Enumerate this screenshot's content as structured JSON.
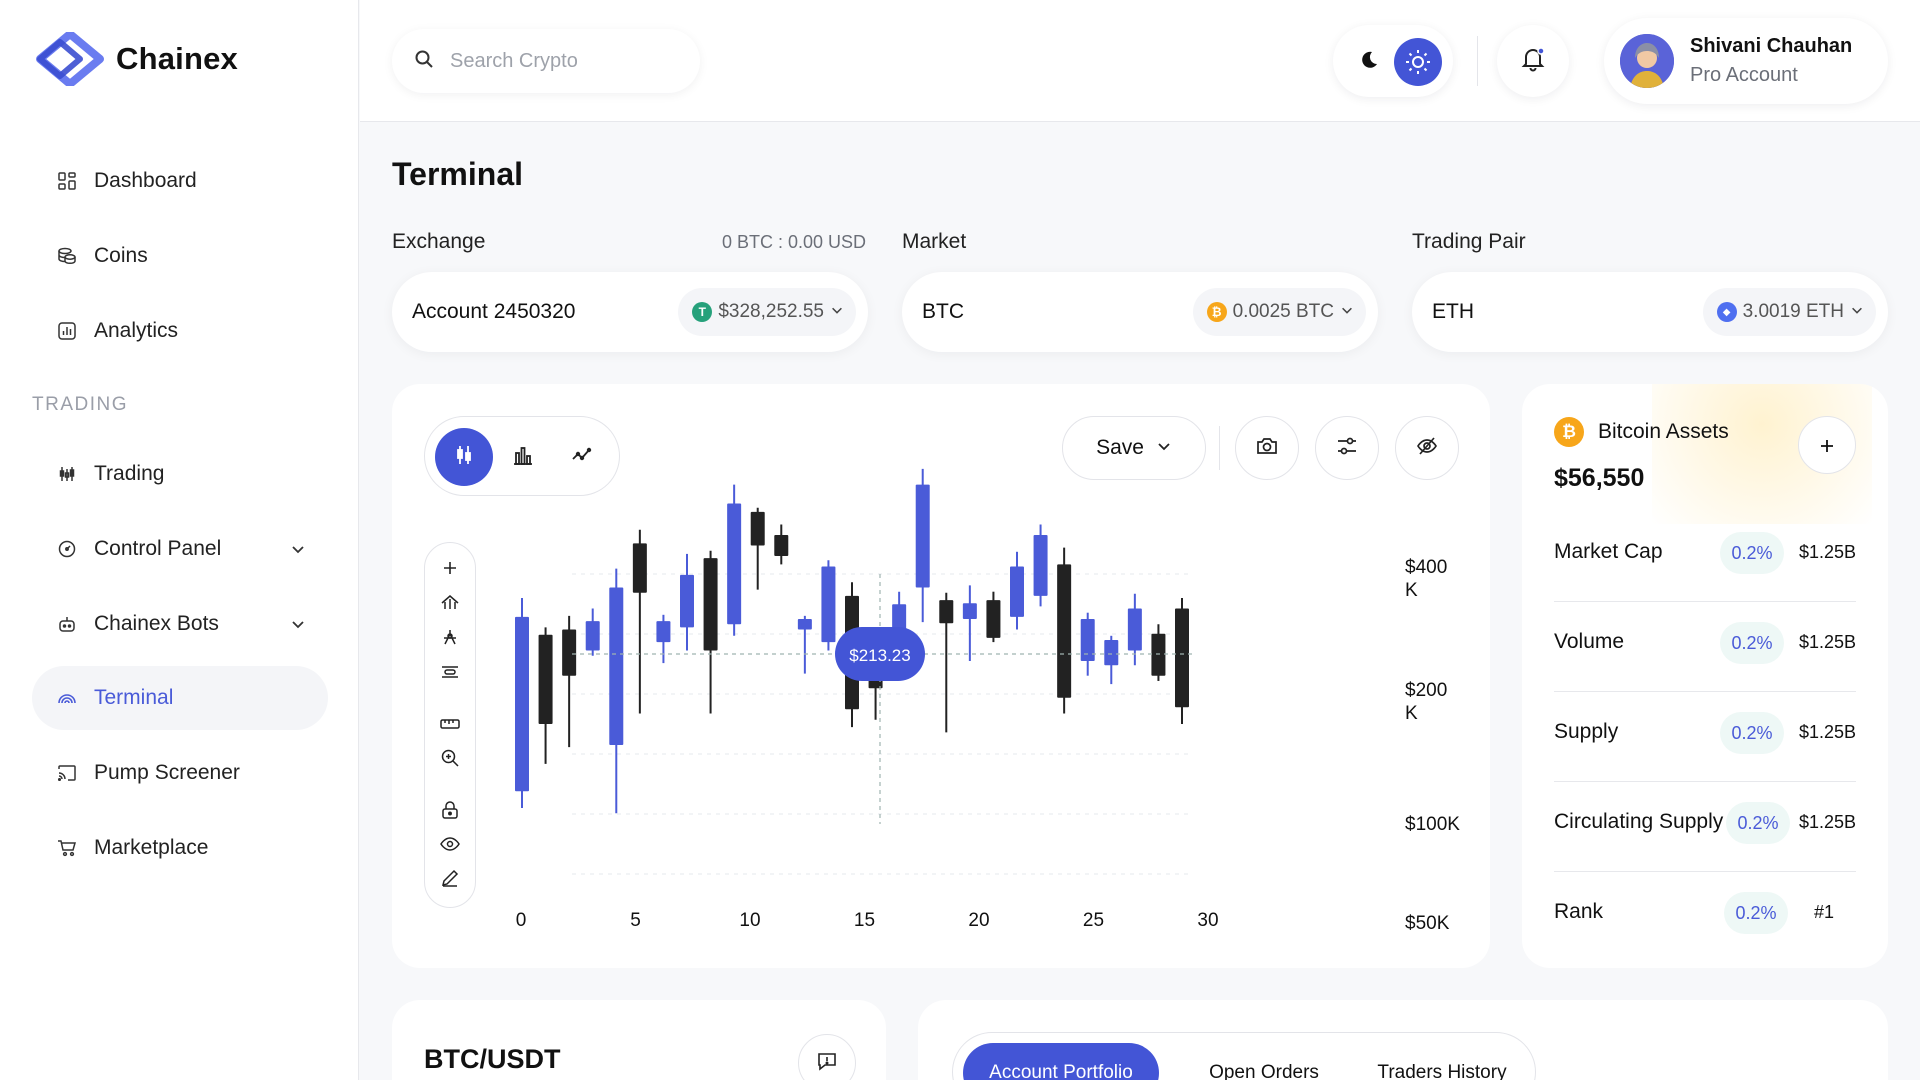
{
  "app": {
    "name": "Chainex"
  },
  "search": {
    "placeholder": "Search Crypto"
  },
  "sidebar": {
    "items": [
      {
        "label": "Dashboard",
        "icon": "grid-icon"
      },
      {
        "label": "Coins",
        "icon": "coins-icon"
      },
      {
        "label": "Analytics",
        "icon": "analytics-icon"
      }
    ],
    "section_label": "TRADING",
    "trading_items": [
      {
        "label": "Trading",
        "icon": "trading-icon"
      },
      {
        "label": "Control Panel",
        "icon": "control-icon",
        "expandable": true
      },
      {
        "label": "Chainex Bots",
        "icon": "bot-icon",
        "expandable": true
      },
      {
        "label": "Terminal",
        "icon": "terminal-icon",
        "active": true
      },
      {
        "label": "Pump Screener",
        "icon": "cast-icon"
      },
      {
        "label": "Marketplace",
        "icon": "cart-icon"
      }
    ]
  },
  "user": {
    "name": "Shivani Chauhan",
    "role": "Pro Account"
  },
  "page": {
    "title": "Terminal"
  },
  "exchange": {
    "label": "Exchange",
    "balance": "0 BTC : 0.00 USD",
    "account": "Account 2450320",
    "amount": "$328,252.55",
    "coin_symbol": "T",
    "coin_color": "#26a17b"
  },
  "market": {
    "label": "Market",
    "value": "BTC",
    "amount": "0.0025 BTC",
    "coin_symbol": "₿",
    "coin_color": "#f7a61a"
  },
  "pair": {
    "label": "Trading Pair",
    "value": "ETH",
    "amount": "3.0019 ETH",
    "coin_symbol": "◆",
    "coin_color": "#4f6ff0"
  },
  "toolbar": {
    "save_label": "Save"
  },
  "chart_data": {
    "type": "candlestick",
    "x_ticks": [
      "0",
      "5",
      "10",
      "15",
      "20",
      "25",
      "30"
    ],
    "y_ticks": [
      {
        "value": 400000,
        "label": "$400 K"
      },
      {
        "value": 200000,
        "label": "$200 K"
      },
      {
        "value": 100000,
        "label": "$100K"
      },
      {
        "value": 50000,
        "label": "$50K"
      }
    ],
    "crosshair_label": "$213.23",
    "colors": {
      "up": "#4a5bd8",
      "down": "#222222"
    },
    "candles": [
      {
        "x": 0,
        "o": 76,
        "c": 242,
        "h": 260,
        "l": 60,
        "up": true
      },
      {
        "x": 1,
        "o": 225,
        "c": 140,
        "h": 232,
        "l": 102,
        "up": false
      },
      {
        "x": 2,
        "o": 230,
        "c": 186,
        "h": 243,
        "l": 118,
        "up": false
      },
      {
        "x": 3,
        "o": 210,
        "c": 238,
        "h": 250,
        "l": 205,
        "up": true
      },
      {
        "x": 4,
        "o": 270,
        "c": 120,
        "h": 288,
        "l": 55,
        "up": true
      },
      {
        "x": 5,
        "o": 312,
        "c": 265,
        "h": 325,
        "l": 150,
        "up": false
      },
      {
        "x": 6,
        "o": 238,
        "c": 218,
        "h": 244,
        "l": 198,
        "up": true
      },
      {
        "x": 7,
        "o": 282,
        "c": 232,
        "h": 302,
        "l": 210,
        "up": true
      },
      {
        "x": 8,
        "o": 298,
        "c": 210,
        "h": 305,
        "l": 150,
        "up": false
      },
      {
        "x": 9,
        "o": 350,
        "c": 235,
        "h": 368,
        "l": 224,
        "up": true
      },
      {
        "x": 10,
        "o": 342,
        "c": 310,
        "h": 346,
        "l": 268,
        "up": false
      },
      {
        "x": 11,
        "o": 320,
        "c": 300,
        "h": 330,
        "l": 292,
        "up": false
      },
      {
        "x": 12,
        "o": 230,
        "c": 240,
        "h": 243,
        "l": 188,
        "up": true
      },
      {
        "x": 13,
        "o": 290,
        "c": 218,
        "h": 296,
        "l": 210,
        "up": true
      },
      {
        "x": 14,
        "o": 262,
        "c": 154,
        "h": 275,
        "l": 137,
        "up": false
      },
      {
        "x": 15,
        "o": 210,
        "c": 174,
        "h": 216,
        "l": 144,
        "up": false
      },
      {
        "x": 16,
        "o": 254,
        "c": 212,
        "h": 266,
        "l": 185,
        "up": true
      },
      {
        "x": 17,
        "o": 368,
        "c": 270,
        "h": 383,
        "l": 237,
        "up": true
      },
      {
        "x": 18,
        "o": 258,
        "c": 236,
        "h": 265,
        "l": 132,
        "up": false
      },
      {
        "x": 19,
        "o": 255,
        "c": 240,
        "h": 272,
        "l": 200,
        "up": true
      },
      {
        "x": 20,
        "o": 258,
        "c": 222,
        "h": 266,
        "l": 218,
        "up": false
      },
      {
        "x": 21,
        "o": 290,
        "c": 242,
        "h": 304,
        "l": 230,
        "up": true
      },
      {
        "x": 22,
        "o": 320,
        "c": 262,
        "h": 330,
        "l": 252,
        "up": true
      },
      {
        "x": 23,
        "o": 292,
        "c": 165,
        "h": 308,
        "l": 150,
        "up": false
      },
      {
        "x": 24,
        "o": 240,
        "c": 200,
        "h": 246,
        "l": 186,
        "up": true
      },
      {
        "x": 25,
        "o": 220,
        "c": 196,
        "h": 224,
        "l": 178,
        "up": true
      },
      {
        "x": 26,
        "o": 250,
        "c": 210,
        "h": 264,
        "l": 196,
        "up": true
      },
      {
        "x": 27,
        "o": 226,
        "c": 186,
        "h": 235,
        "l": 181,
        "up": false
      },
      {
        "x": 28,
        "o": 250,
        "c": 156,
        "h": 260,
        "l": 140,
        "up": false
      }
    ]
  },
  "assets": {
    "title": "Bitcoin Assets",
    "value": "$56,550",
    "rows": [
      {
        "label": "Market Cap",
        "pct": "0.2%",
        "amount": "$1.25B"
      },
      {
        "label": "Volume",
        "pct": "0.2%",
        "amount": "$1.25B"
      },
      {
        "label": "Supply",
        "pct": "0.2%",
        "amount": "$1.25B"
      },
      {
        "label": "Circulating Supply",
        "pct": "0.2%",
        "amount": "$1.25B"
      },
      {
        "label": "Rank",
        "pct": "0.2%",
        "amount": "#1"
      }
    ]
  },
  "trade_pair": {
    "title": "BTC/USDT"
  },
  "tabs": [
    {
      "label": "Account Portfolio",
      "active": true
    },
    {
      "label": "Open Orders"
    },
    {
      "label": "Traders History"
    }
  ]
}
